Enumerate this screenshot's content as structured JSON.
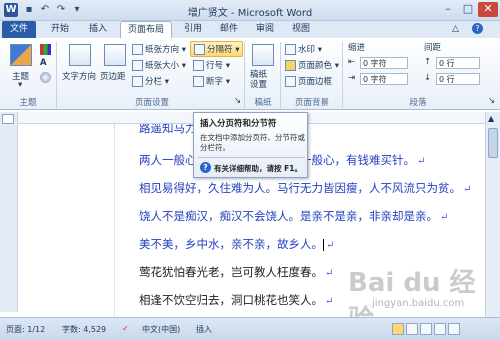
{
  "window": {
    "title": "增广贤文 - Microsoft Word"
  },
  "quick_access": [
    "save-icon",
    "undo-icon",
    "redo-icon",
    "open-icon"
  ],
  "tabs": [
    {
      "label": "文件"
    },
    {
      "label": "开始"
    },
    {
      "label": "插入"
    },
    {
      "label": "页面布局"
    },
    {
      "label": "引用"
    },
    {
      "label": "邮件"
    },
    {
      "label": "审阅"
    },
    {
      "label": "视图"
    }
  ],
  "ribbon": {
    "theme": {
      "label": "主题",
      "group": "主题"
    },
    "page_setup": {
      "text_direction": "文字方向",
      "margins": "页边距",
      "orientation": "纸张方向",
      "size": "纸张大小",
      "columns": "分栏",
      "breaks": "分隔符",
      "line_numbers": "行号",
      "hyphenation": "断字",
      "group": "页面设置"
    },
    "draft": {
      "label": "稿纸设置",
      "group": "稿纸"
    },
    "page_background": {
      "watermark": "水印",
      "page_color": "页面颜色",
      "page_borders": "页面边框",
      "group": "页面背景"
    },
    "paragraph": {
      "indent": "缩进",
      "spacing": "间距",
      "left_value": "0 字符",
      "right_value": "0 字符",
      "before_value": "0 行",
      "after_value": "0 行",
      "group": "段落"
    }
  },
  "tooltip": {
    "title": "插入分页符和分节符",
    "body": "在文档中添加分页符、分节符或分栏符。",
    "help": "有关详细帮助，请按 F1。"
  },
  "document": {
    "lines": [
      {
        "text": "路遥知马力，日久见人心。",
        "color": "blue"
      },
      {
        "text": "两人一般心，有钱堪买金；一人一般心，有钱难买针。",
        "color": "blue"
      },
      {
        "text": "相见易得好，久住难为人。马行无力皆因瘦，人不风流只为贫。",
        "color": "blue"
      },
      {
        "text": "饶人不是痴汉，痴汉不会饶人。是亲不是亲，非亲却是亲。",
        "color": "blue"
      },
      {
        "text": "美不美，乡中水，亲不亲，故乡人。",
        "color": "blue"
      },
      {
        "text": "莺花犹怕春光老，岂可教人枉度春。",
        "color": "black"
      },
      {
        "text": "相逢不饮空归去，洞口桃花也笑人。",
        "color": "black"
      }
    ]
  },
  "status": {
    "page": "页面: 1/12",
    "words": "字数: 4,529",
    "language": "中文(中国)",
    "mode": "插入"
  },
  "watermark": {
    "brand": "Bai du 经验",
    "url": "jingyan.baidu.com"
  }
}
